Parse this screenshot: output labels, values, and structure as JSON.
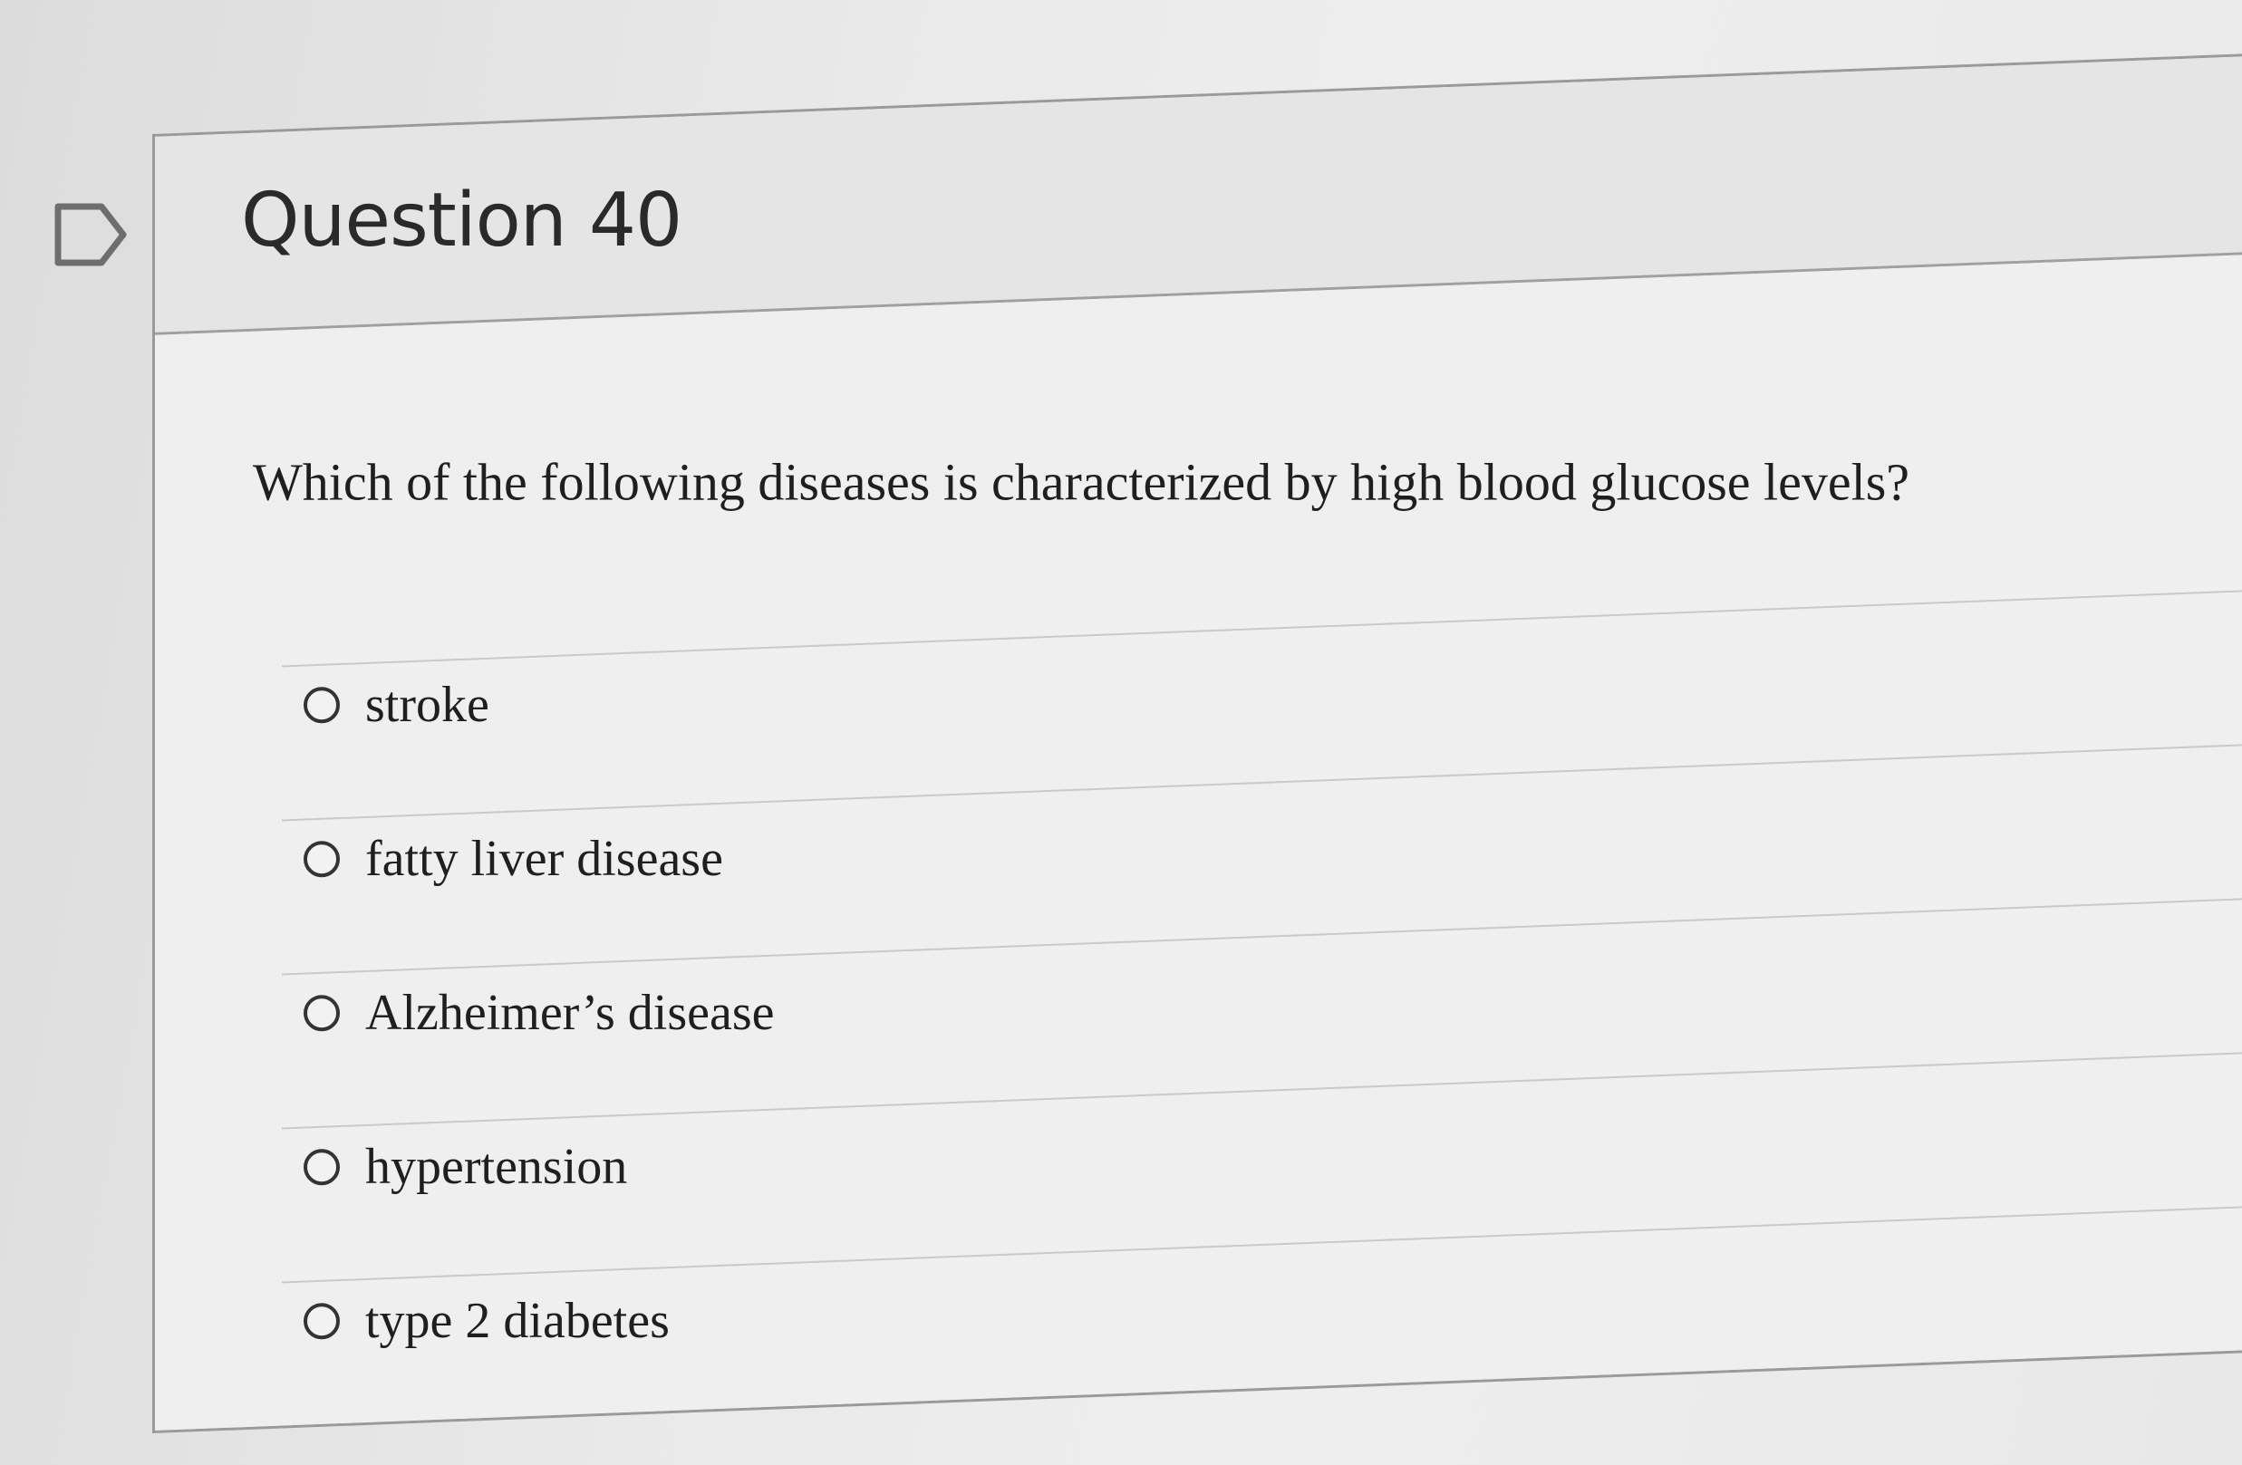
{
  "question": {
    "title": "Question 40",
    "text": "Which of the following diseases is characterized by high blood glucose levels?",
    "bookmark_icon": "bookmark-flag-icon"
  },
  "answers": [
    {
      "label": "stroke",
      "selected": false
    },
    {
      "label": "fatty liver disease",
      "selected": false
    },
    {
      "label": "Alzheimer’s disease",
      "selected": false
    },
    {
      "label": "hypertension",
      "selected": false
    },
    {
      "label": "type 2 diabetes",
      "selected": false
    }
  ]
}
